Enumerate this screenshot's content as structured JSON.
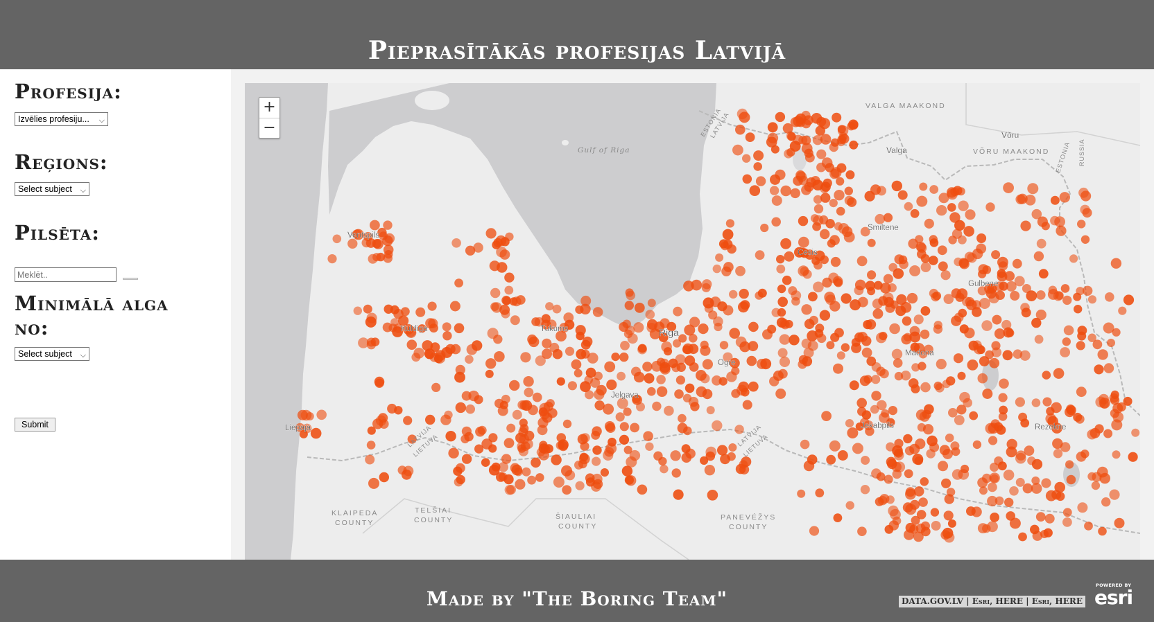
{
  "header": {
    "title": "Pieprasītākās profesijas Latvijā"
  },
  "sidebar": {
    "profession_label": "Profesija:",
    "profession_select": "Izvēlies profesiju...",
    "region_label": "Reģions:",
    "region_select": "Select subject",
    "city_label": "Pilsēta:",
    "city_placeholder": "Meklēt..",
    "min_salary_label_line1": "Minimālā alga",
    "min_salary_label_line2": "no:",
    "salary_select": "Select subject",
    "submit_label": "Submit"
  },
  "map": {
    "zoom_in": "+",
    "zoom_out": "−",
    "sea_label": "Gulf of Riga",
    "border_labels": {
      "estonia": "ESTONIA",
      "latvia": "LATVIJA",
      "lietuva": "LIETUVA",
      "russia": "RUSSIA"
    },
    "region_labels": {
      "valga_maakond": "VALGA MAAKOND",
      "voru_maakond": "VÕRU MAAKOND",
      "klaipeda_1": "KLAIPEDA",
      "klaipeda_2": "COUNTY",
      "telsiai_1": "TELŠIAI",
      "telsiai_2": "COUNTY",
      "siauliai_1": "ŠIAULIAI",
      "siauliai_2": "COUNTY",
      "panevezys_1": "PANEVĖŽYS",
      "panevezys_2": "COUNTY"
    },
    "cities": {
      "ventspils": "Ventspils",
      "kuldiga": "Kuldiga",
      "tukums": "Tukums",
      "riga": "Riga",
      "jelgava": "Jelgava",
      "liepaja": "Liepaja",
      "ogre": "Ogre",
      "cesis": "Cesis",
      "valga": "Valga",
      "voru": "Võru",
      "smiltene": "Smiltene",
      "gulbene": "Gulbene",
      "madona": "Madona",
      "jekabpils": "Jekabpils",
      "rezekne": "Rezekne"
    },
    "marker_color": "#ee4d0f",
    "land_color": "#ededed",
    "sea_color": "#cdcdcf"
  },
  "footer": {
    "credit": "Made by \"The Boring Team\"",
    "attribution": "DATA.GOV.LV | Esri, HERE | Esri, HERE",
    "esri_powered": "POWERED BY",
    "esri_brand": "esri"
  }
}
